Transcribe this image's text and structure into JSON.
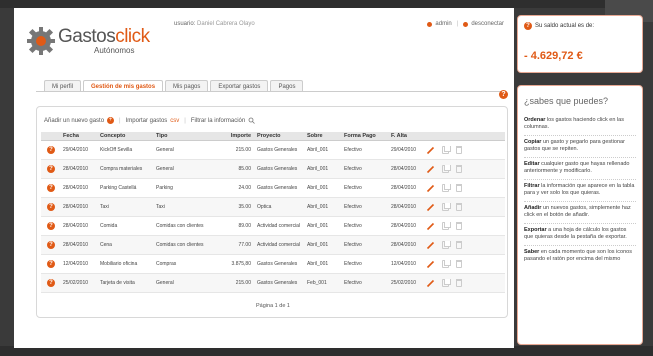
{
  "header": {
    "logo_main": "Gastos",
    "logo_accent": "click",
    "logo_sub": "Autónomos",
    "user_label": "usuario:",
    "user_name": "Daniel Cabrera Olayo",
    "admin_link": "admin",
    "logout_link": "desconectar"
  },
  "tabs": [
    "Mi perfil",
    "Gestión de mis gastos",
    "Mis pagos",
    "Exportar gastos",
    "Pagos"
  ],
  "actions": {
    "add": "Añadir un nuevo gasto",
    "import": "Importar gastos",
    "import_format": "csv",
    "filter": "Filtrar la información"
  },
  "table": {
    "headers": [
      "Fecha",
      "Concepto",
      "Tipo",
      "Importe",
      "Proyecto",
      "Sobre",
      "Forma Pago",
      "F. Alta"
    ],
    "rows": [
      [
        "29/04/2010",
        "KickOff Sevilla",
        "General",
        "215.00",
        "Gastos Generales",
        "Abril_001",
        "Efectivo",
        "29/04/2010"
      ],
      [
        "28/04/2010",
        "Compra materiales",
        "General",
        "85.00",
        "Gastos Generales",
        "Abril_001",
        "Efectivo",
        "28/04/2010"
      ],
      [
        "28/04/2010",
        "Parking Castellá",
        "Parking",
        "24.00",
        "Gastos Generales",
        "Abril_001",
        "Efectivo",
        "28/04/2010"
      ],
      [
        "28/04/2010",
        "Taxi",
        "Taxi",
        "35.00",
        "Óptica",
        "Abril_001",
        "Efectivo",
        "28/04/2010"
      ],
      [
        "28/04/2010",
        "Comida",
        "Comidas con clientes",
        "89.00",
        "Actividad comercial",
        "Abril_001",
        "Efectivo",
        "28/04/2010"
      ],
      [
        "28/04/2010",
        "Cena",
        "Comidas con clientes",
        "77.00",
        "Actividad comercial",
        "Abril_001",
        "Efectivo",
        "28/04/2010"
      ],
      [
        "12/04/2010",
        "Mobiliario oficina",
        "Compras",
        "3.875,80",
        "Gastos Generales",
        "Abril_001",
        "Efectivo",
        "12/04/2010"
      ],
      [
        "25/02/2010",
        "Tarjeta de visita",
        "General",
        "215.00",
        "Gastos Generales",
        "Feb_001",
        "Efectivo",
        "25/02/2010"
      ]
    ],
    "pagination": "Página 1 de 1"
  },
  "balance": {
    "label": "Su saldo actual es de:",
    "value": "- 4.629,72 €"
  },
  "tips": {
    "title": "¿sabes que puedes?",
    "items": [
      {
        "bold": "Ordenar",
        "text": " los gastos haciendo click en las columnas."
      },
      {
        "bold": "Copiar",
        "text": " un gasto y pegarlo para gestionar gastos que se repiten."
      },
      {
        "bold": "Editar",
        "text": " cualquier gasto que hayas rellenado anteriormente y modificarlo."
      },
      {
        "bold": "Filtrar",
        "text": " la información que aparece en la tabla para y ver solo los que quieras."
      },
      {
        "bold": "Añadir",
        "text": " un nuevos gastos, simplemente haz click en el botón de añadir."
      },
      {
        "bold": "Exportar",
        "text": " a una hoja de cálculo los gastos que quieras desde la pestaña de exportar."
      },
      {
        "bold": "Saber",
        "text": " en cada momento que son los iconos pasando el ratón por encima del mismo"
      }
    ]
  },
  "colors": {
    "accent": "#e05a16",
    "border_accent": "#e8a893"
  }
}
